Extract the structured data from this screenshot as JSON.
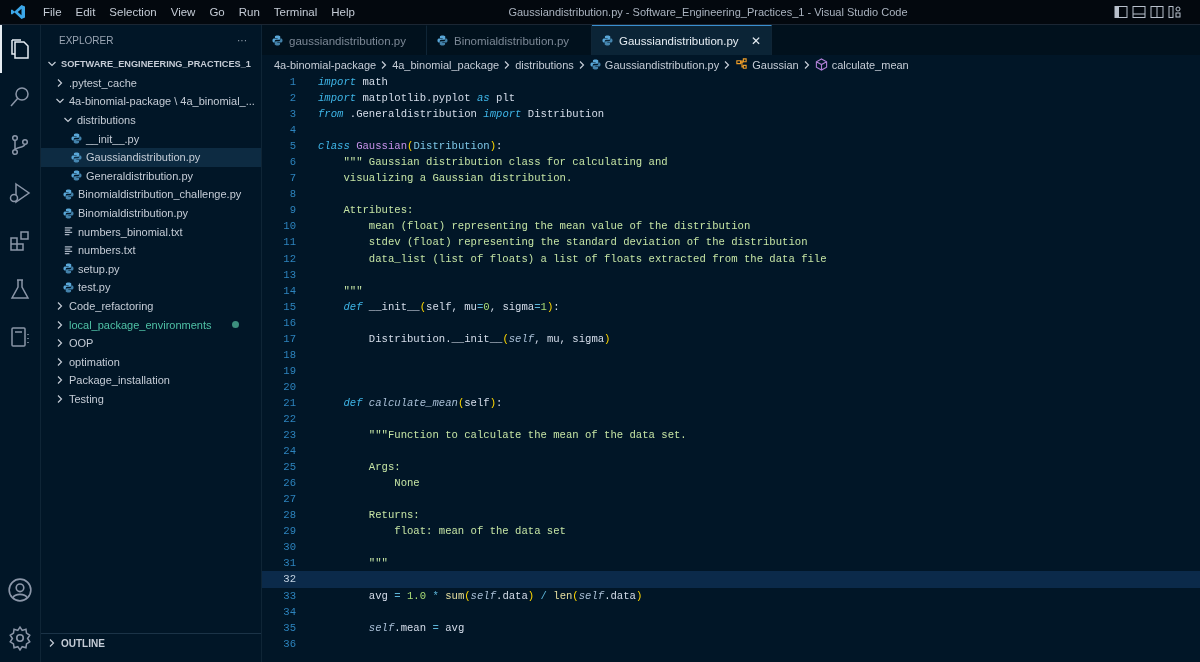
{
  "menu": [
    "File",
    "Edit",
    "Selection",
    "View",
    "Go",
    "Run",
    "Terminal",
    "Help"
  ],
  "window": {
    "title": "Gaussiandistribution.py - Software_Engineering_Practices_1 - Visual Studio Code"
  },
  "activity_bar": [
    {
      "kind": "files",
      "selected": true
    },
    {
      "kind": "search",
      "selected": false
    },
    {
      "kind": "source-control",
      "selected": false
    },
    {
      "kind": "run",
      "selected": false
    },
    {
      "kind": "extensions",
      "selected": false
    },
    {
      "kind": "testing",
      "selected": false
    },
    {
      "kind": "notebook",
      "selected": false
    }
  ],
  "activity_bottom": [
    {
      "kind": "account"
    },
    {
      "kind": "settings"
    }
  ],
  "sidebar": {
    "title": "EXPLORER",
    "more": "···",
    "tree": [
      {
        "label": "SOFTWARE_ENGINEERING_PRACTICES_1",
        "kind": "root",
        "expanded": true,
        "selected": false,
        "modified": false,
        "children": [
          {
            "label": ".pytest_cache",
            "kind": "folder",
            "expanded": false,
            "selected": false,
            "modified": false
          },
          {
            "label": "4a-binomial-package \\ 4a_binomial_...",
            "kind": "folder",
            "expanded": true,
            "selected": false,
            "modified": false,
            "children": [
              {
                "label": "distributions",
                "kind": "folder",
                "expanded": true,
                "selected": false,
                "modified": false,
                "children": [
                  {
                    "label": "__init__.py",
                    "kind": "python",
                    "selected": false,
                    "modified": false
                  },
                  {
                    "label": "Gaussiandistribution.py",
                    "kind": "python",
                    "selected": true,
                    "modified": false
                  },
                  {
                    "label": "Generaldistribution.py",
                    "kind": "python",
                    "selected": false,
                    "modified": false
                  }
                ]
              },
              {
                "label": "Binomialdistribution_challenge.py",
                "kind": "python",
                "selected": false,
                "modified": false
              },
              {
                "label": "Binomialdistribution.py",
                "kind": "python",
                "selected": false,
                "modified": false
              },
              {
                "label": "numbers_binomial.txt",
                "kind": "text",
                "selected": false,
                "modified": false
              },
              {
                "label": "numbers.txt",
                "kind": "text",
                "selected": false,
                "modified": false
              },
              {
                "label": "setup.py",
                "kind": "python",
                "selected": false,
                "modified": false
              },
              {
                "label": "test.py",
                "kind": "python",
                "selected": false,
                "modified": false
              }
            ]
          },
          {
            "label": "Code_refactoring",
            "kind": "folder",
            "expanded": false,
            "selected": false,
            "modified": false
          },
          {
            "label": "local_package_environments",
            "kind": "folder",
            "expanded": false,
            "selected": false,
            "modified": true
          },
          {
            "label": "OOP",
            "kind": "folder",
            "expanded": false,
            "selected": false,
            "modified": false
          },
          {
            "label": "optimation",
            "kind": "folder",
            "expanded": false,
            "selected": false,
            "modified": false
          },
          {
            "label": "Package_installation",
            "kind": "folder",
            "expanded": false,
            "selected": false,
            "modified": false
          },
          {
            "label": "Testing",
            "kind": "folder",
            "expanded": false,
            "selected": false,
            "modified": false
          }
        ]
      }
    ],
    "outline": {
      "label": "OUTLINE",
      "expanded": false
    }
  },
  "tabs": [
    {
      "label": "gaussiandistribution.py",
      "selected": false
    },
    {
      "label": "Binomialdistribution.py",
      "selected": false
    },
    {
      "label": "Gaussiandistribution.py",
      "selected": true,
      "close": "✕"
    }
  ],
  "breadcrumbs": [
    {
      "label": "4a-binomial-package",
      "kind": "folder"
    },
    {
      "label": "4a_binomial_package",
      "kind": "folder"
    },
    {
      "label": "distributions",
      "kind": "folder"
    },
    {
      "label": "Gaussiandistribution.py",
      "kind": "python"
    },
    {
      "label": "Gaussian",
      "kind": "class"
    },
    {
      "label": "calculate_mean",
      "kind": "method"
    }
  ],
  "code": [
    {
      "number": "1",
      "current": false,
      "tokens": [
        {
          "kind": "kw",
          "text": "import"
        },
        {
          "kind": "pl",
          "text": " math"
        }
      ]
    },
    {
      "number": "2",
      "current": false,
      "tokens": [
        {
          "kind": "kw",
          "text": "import"
        },
        {
          "kind": "pl",
          "text": " matplotlib.pyplot "
        },
        {
          "kind": "kw",
          "text": "as"
        },
        {
          "kind": "pl",
          "text": " plt"
        }
      ]
    },
    {
      "number": "3",
      "current": false,
      "tokens": [
        {
          "kind": "kw",
          "text": "from"
        },
        {
          "kind": "pl",
          "text": " .Generaldistribution "
        },
        {
          "kind": "kw",
          "text": "import"
        },
        {
          "kind": "pl",
          "text": " Distribution"
        }
      ]
    },
    {
      "number": "4",
      "current": false
    },
    {
      "number": "5",
      "current": false,
      "tokens": [
        {
          "kind": "kw",
          "text": "class "
        },
        {
          "kind": "cls",
          "text": "Gaussian"
        },
        {
          "kind": "par",
          "text": "("
        },
        {
          "kind": "base",
          "text": "Distribution"
        },
        {
          "kind": "par",
          "text": ")"
        },
        {
          "kind": "pl",
          "text": ":"
        }
      ]
    },
    {
      "number": "6",
      "current": false,
      "tokens": [
        {
          "kind": "str",
          "text": "    \"\"\" Gaussian distribution class for calculating and"
        }
      ]
    },
    {
      "number": "7",
      "current": false,
      "tokens": [
        {
          "kind": "str",
          "text": "    visualizing a Gaussian distribution."
        }
      ]
    },
    {
      "number": "8",
      "current": false
    },
    {
      "number": "9",
      "current": false,
      "tokens": [
        {
          "kind": "str",
          "text": "    Attributes:"
        }
      ]
    },
    {
      "number": "10",
      "current": false,
      "tokens": [
        {
          "kind": "str",
          "text": "        mean (float) representing the mean value of the distribution"
        }
      ]
    },
    {
      "number": "11",
      "current": false,
      "tokens": [
        {
          "kind": "str",
          "text": "        stdev (float) representing the standard deviation of the distribution"
        }
      ]
    },
    {
      "number": "12",
      "current": false,
      "tokens": [
        {
          "kind": "str",
          "text": "        data_list (list of floats) a list of floats extracted from the data file"
        }
      ]
    },
    {
      "number": "13",
      "current": false
    },
    {
      "number": "14",
      "current": false,
      "tokens": [
        {
          "kind": "str",
          "text": "    \"\"\""
        }
      ]
    },
    {
      "number": "15",
      "current": false,
      "tokens": [
        {
          "kind": "kw",
          "text": "    def"
        },
        {
          "kind": "pl",
          "text": " __init__"
        },
        {
          "kind": "par",
          "text": "("
        },
        {
          "kind": "pl",
          "text": "self, mu"
        },
        {
          "kind": "op",
          "text": "="
        },
        {
          "kind": "num",
          "text": "0"
        },
        {
          "kind": "pl",
          "text": ", sigma"
        },
        {
          "kind": "op",
          "text": "="
        },
        {
          "kind": "num",
          "text": "1"
        },
        {
          "kind": "par",
          "text": ")"
        },
        {
          "kind": "pl",
          "text": ":"
        }
      ]
    },
    {
      "number": "16",
      "current": false
    },
    {
      "number": "17",
      "current": false,
      "tokens": [
        {
          "kind": "pl",
          "text": "        Distribution.__init__"
        },
        {
          "kind": "par",
          "text": "("
        },
        {
          "kind": "self",
          "text": "self"
        },
        {
          "kind": "pl",
          "text": ", mu, sigma"
        },
        {
          "kind": "par",
          "text": ")"
        }
      ]
    },
    {
      "number": "18",
      "current": false
    },
    {
      "number": "19",
      "current": false
    },
    {
      "number": "20",
      "current": false
    },
    {
      "number": "21",
      "current": false,
      "tokens": [
        {
          "kind": "kw",
          "text": "    def "
        },
        {
          "kind": "fn",
          "text": "calculate_mean"
        },
        {
          "kind": "par",
          "text": "("
        },
        {
          "kind": "pl",
          "text": "self"
        },
        {
          "kind": "par",
          "text": ")"
        },
        {
          "kind": "pl",
          "text": ":"
        }
      ]
    },
    {
      "number": "22",
      "current": false
    },
    {
      "number": "23",
      "current": false,
      "tokens": [
        {
          "kind": "str",
          "text": "        \"\"\"Function to calculate the mean of the data set."
        }
      ]
    },
    {
      "number": "24",
      "current": false
    },
    {
      "number": "25",
      "current": false,
      "tokens": [
        {
          "kind": "str",
          "text": "        Args:"
        }
      ]
    },
    {
      "number": "26",
      "current": false,
      "tokens": [
        {
          "kind": "str",
          "text": "            None"
        }
      ]
    },
    {
      "number": "27",
      "current": false
    },
    {
      "number": "28",
      "current": false,
      "tokens": [
        {
          "kind": "str",
          "text": "        Returns:"
        }
      ]
    },
    {
      "number": "29",
      "current": false,
      "tokens": [
        {
          "kind": "str",
          "text": "            float: mean of the data set"
        }
      ]
    },
    {
      "number": "30",
      "current": false
    },
    {
      "number": "31",
      "current": false,
      "tokens": [
        {
          "kind": "str",
          "text": "        \"\"\""
        }
      ]
    },
    {
      "number": "32",
      "current": true
    },
    {
      "number": "33",
      "current": false,
      "tokens": [
        {
          "kind": "pl",
          "text": "        avg "
        },
        {
          "kind": "op",
          "text": "= "
        },
        {
          "kind": "num",
          "text": "1.0 "
        },
        {
          "kind": "op",
          "text": "* "
        },
        {
          "kind": "bi",
          "text": "sum"
        },
        {
          "kind": "par",
          "text": "("
        },
        {
          "kind": "self",
          "text": "self"
        },
        {
          "kind": "pl",
          "text": ".data"
        },
        {
          "kind": "par",
          "text": ")"
        },
        {
          "kind": "op",
          "text": " / "
        },
        {
          "kind": "bi",
          "text": "len"
        },
        {
          "kind": "par",
          "text": "("
        },
        {
          "kind": "self",
          "text": "self"
        },
        {
          "kind": "pl",
          "text": ".data"
        },
        {
          "kind": "par",
          "text": ")"
        }
      ]
    },
    {
      "number": "34",
      "current": false
    },
    {
      "number": "35",
      "current": false,
      "tokens": [
        {
          "kind": "self",
          "text": "        self"
        },
        {
          "kind": "pl",
          "text": ".mean "
        },
        {
          "kind": "op",
          "text": "="
        },
        {
          "kind": "pl",
          "text": " avg"
        }
      ]
    },
    {
      "number": "36",
      "current": false
    }
  ]
}
